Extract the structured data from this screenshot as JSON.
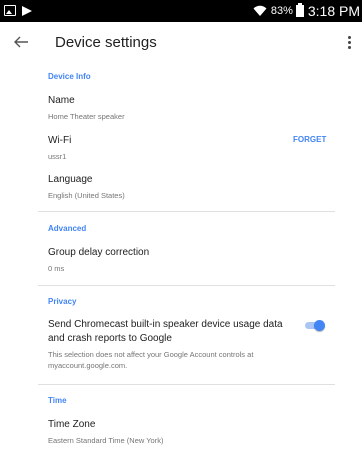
{
  "status_bar": {
    "battery": "83%",
    "time": "3:18 PM",
    "icons": [
      "gallery-icon",
      "cast-icon",
      "wifi-icon",
      "battery-icon"
    ]
  },
  "app_bar": {
    "title": "Device settings",
    "icons": [
      "back-arrow-icon",
      "more-vert-icon"
    ]
  },
  "sections": {
    "device_info": {
      "header": "Device Info",
      "name": {
        "title": "Name",
        "value": "Home Theater speaker"
      },
      "wifi": {
        "title": "Wi-Fi",
        "value": "ussr1",
        "action": "FORGET"
      },
      "language": {
        "title": "Language",
        "value": "English (United States)"
      }
    },
    "advanced": {
      "header": "Advanced",
      "group_delay": {
        "title": "Group delay correction",
        "value": "0 ms"
      }
    },
    "privacy": {
      "header": "Privacy",
      "usage": {
        "title": "Send Chromecast built-in speaker device usage data and crash reports to Google",
        "description": "This selection does not affect your Google Account controls at myaccount.google.com.",
        "enabled": true
      }
    },
    "time": {
      "header": "Time",
      "time_zone": {
        "title": "Time Zone",
        "value": "Eastern Standard Time (New York)"
      }
    }
  },
  "colors": {
    "accent": "#4285f4",
    "status_bar": "#000000"
  }
}
